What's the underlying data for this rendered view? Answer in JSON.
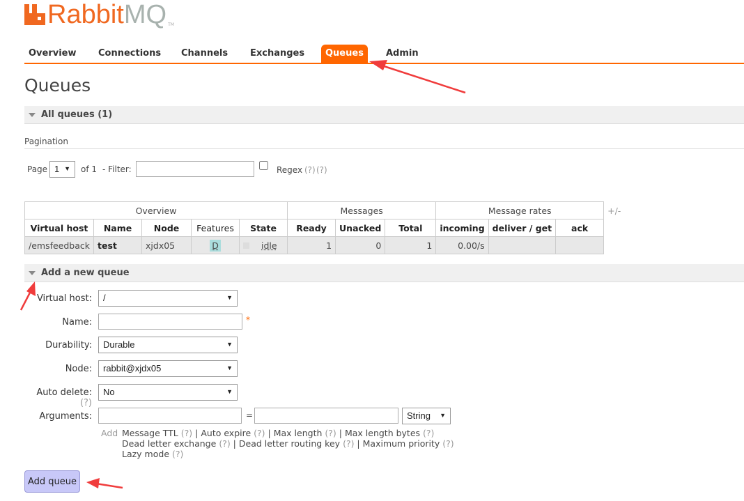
{
  "logo": {
    "part1": "Rabbit",
    "part2": "MQ",
    "tm": "TM"
  },
  "nav": [
    "Overview",
    "Connections",
    "Channels",
    "Exchanges",
    "Queues",
    "Admin"
  ],
  "page_title": "Queues",
  "all_queues": "All queues (1)",
  "pagination": {
    "heading": "Pagination",
    "page_label": "Page",
    "page_value": "1",
    "of": "of 1",
    "filter_label": "- Filter:",
    "filter_value": "",
    "regex": "Regex",
    "help1": "(?)",
    "help2": "(?)"
  },
  "table": {
    "groups": [
      "Overview",
      "Messages",
      "Message rates"
    ],
    "plusminus": "+/-",
    "headers": [
      "Virtual host",
      "Name",
      "Node",
      "Features",
      "State",
      "Ready",
      "Unacked",
      "Total",
      "incoming",
      "deliver / get",
      "ack"
    ],
    "rows": [
      {
        "vhost": "/emsfeedback",
        "name": "test",
        "node": "xjdx05",
        "features": "D",
        "state": "idle",
        "ready": "1",
        "unacked": "0",
        "total": "1",
        "incoming": "0.00/s",
        "deliver": "",
        "ack": ""
      }
    ]
  },
  "add_queue": {
    "heading": "Add a new queue",
    "vhost_label": "Virtual host:",
    "vhost_value": "/",
    "name_label": "Name:",
    "name_value": "",
    "required": "*",
    "durability_label": "Durability:",
    "durability_value": "Durable",
    "node_label": "Node:",
    "node_value": "rabbit@xjdx05",
    "autodelete_label": "Auto delete:",
    "autodelete_help": "(?)",
    "autodelete_value": "No",
    "arguments_label": "Arguments:",
    "equals": "=",
    "arg_type": "String",
    "add": "Add",
    "line1": [
      "Message TTL",
      "Auto expire",
      "Max length",
      "Max length bytes"
    ],
    "line2": [
      "Dead letter exchange",
      "Dead letter routing key",
      "Maximum priority"
    ],
    "line3": [
      "Lazy mode"
    ],
    "help": "(?)",
    "button": "Add queue"
  },
  "colors": {
    "accent": "#ff6600",
    "annotation": "#f03c3c"
  }
}
